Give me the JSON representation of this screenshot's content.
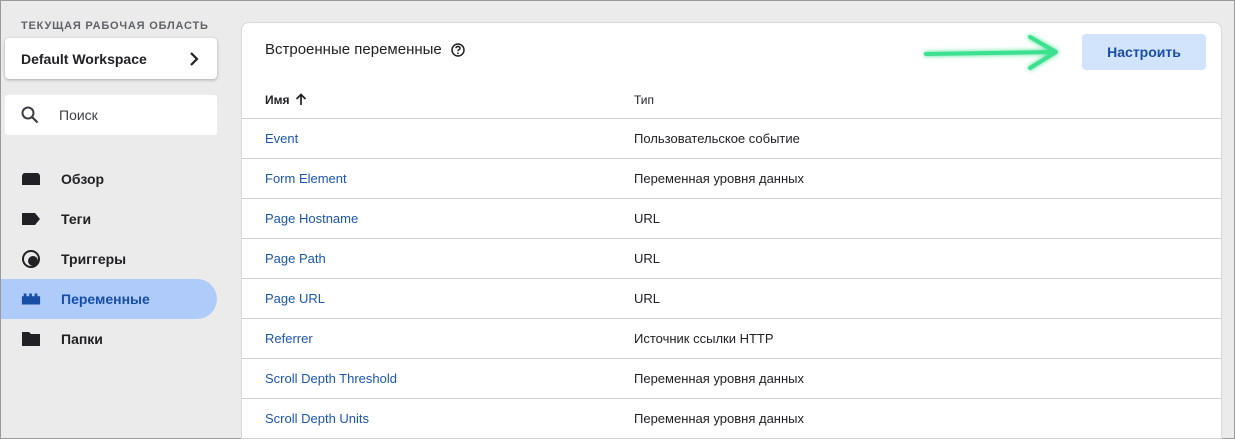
{
  "workspace": {
    "caption": "ТЕКУЩАЯ РАБОЧАЯ ОБЛАСТЬ",
    "name": "Default Workspace"
  },
  "search": {
    "placeholder": "Поиск"
  },
  "nav": {
    "items": [
      {
        "label": "Обзор",
        "icon": "overview-icon",
        "active": false
      },
      {
        "label": "Теги",
        "icon": "tag-icon",
        "active": false
      },
      {
        "label": "Триггеры",
        "icon": "trigger-icon",
        "active": false
      },
      {
        "label": "Переменные",
        "icon": "variables-icon",
        "active": true
      },
      {
        "label": "Папки",
        "icon": "folder-icon",
        "active": false
      }
    ]
  },
  "main": {
    "title": "Встроенные переменные",
    "configure_label": "Настроить",
    "columns": {
      "name": "Имя",
      "type": "Тип"
    },
    "rows": [
      {
        "name": "Event",
        "type": "Пользовательское событие"
      },
      {
        "name": "Form Element",
        "type": "Переменная уровня данных"
      },
      {
        "name": "Page Hostname",
        "type": "URL"
      },
      {
        "name": "Page Path",
        "type": "URL"
      },
      {
        "name": "Page URL",
        "type": "URL"
      },
      {
        "name": "Referrer",
        "type": "Источник ссылки HTTP"
      },
      {
        "name": "Scroll Depth Threshold",
        "type": "Переменная уровня данных"
      },
      {
        "name": "Scroll Depth Units",
        "type": "Переменная уровня данных"
      }
    ]
  },
  "colors": {
    "active_nav_bg": "#aecbfa",
    "active_nav_text": "#174ea6",
    "button_bg": "#d2e3fc",
    "link": "#1a56b0",
    "arrow": "#3ee08f"
  }
}
